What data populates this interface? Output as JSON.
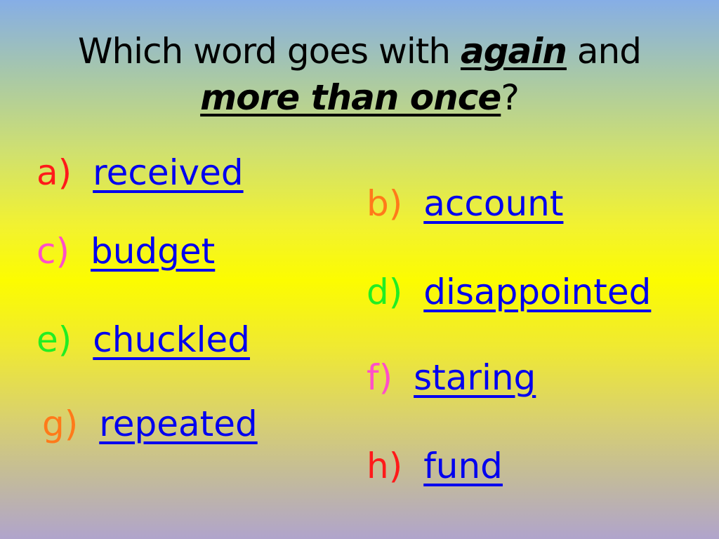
{
  "question": {
    "part1": "Which word goes with ",
    "key1": "again",
    "part2": " and",
    "key2": "more than once",
    "part3": "?"
  },
  "colors": {
    "word": "#0000ee",
    "a": "#ff1a1a",
    "b": "#ff7a1a",
    "c": "#ff4fc8",
    "d": "#22ee22",
    "e": "#22ee22",
    "f": "#ff4fc8",
    "g": "#ff7a1a",
    "h": "#ff1a1a"
  },
  "options": [
    {
      "letter": "a)",
      "word": "received"
    },
    {
      "letter": "b)",
      "word": "account"
    },
    {
      "letter": "c)",
      "word": "budget"
    },
    {
      "letter": "d)",
      "word": "disappointed"
    },
    {
      "letter": "e)",
      "word": "chuckled"
    },
    {
      "letter": "f)",
      "word": "staring"
    },
    {
      "letter": "g)",
      "word": "repeated"
    },
    {
      "letter": "h)",
      "word": "fund"
    }
  ]
}
